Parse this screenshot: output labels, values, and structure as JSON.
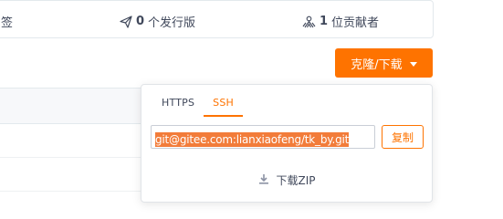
{
  "stats": {
    "tags_label": "签",
    "releases_count": "0",
    "releases_label": "个发行版",
    "contributors_count": "1",
    "contributors_label": "位贡献者"
  },
  "clone_button": {
    "label": "克隆/下载"
  },
  "clone_dropdown": {
    "tabs": [
      {
        "label": "HTTPS",
        "active": false
      },
      {
        "label": "SSH",
        "active": true
      }
    ],
    "url_value": "git@gitee.com:lianxiaofeng/tk_by.git",
    "copy_label": "复制",
    "download_label": "下载ZIP"
  },
  "colors": {
    "accent": "#fe7300",
    "selection": "#f27c3a",
    "text": "#40485b",
    "border": "#e3e9ed"
  },
  "icons": {
    "releases": "paper-plane-icon",
    "contributors": "users-icon",
    "download": "download-icon",
    "dropdown": "caret-down-icon"
  }
}
